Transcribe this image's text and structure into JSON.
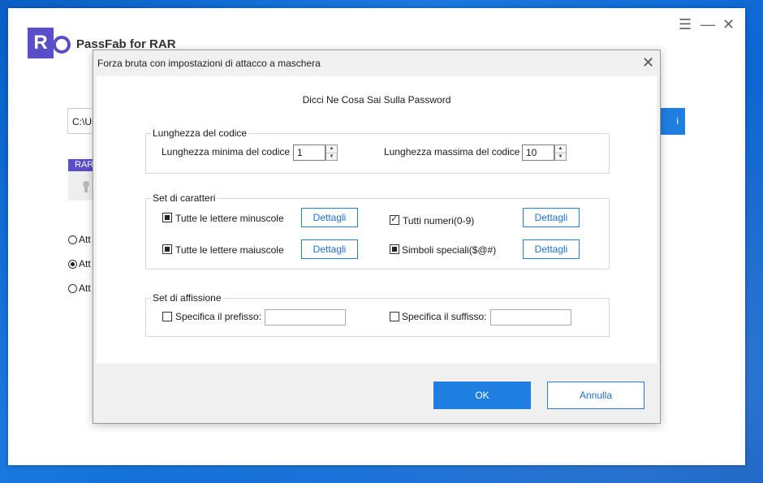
{
  "app": {
    "title": "PassFab for RAR",
    "logo_letter": "R",
    "path_value": "C:\\Us",
    "browse_label": "i",
    "rar_tab": "RAR",
    "attack_options": [
      "Att",
      "Att",
      "Att"
    ]
  },
  "dialog": {
    "title": "Forza bruta con impostazioni di attacco a maschera",
    "heading": "Dicci Ne Cosa Sai Sulla Password",
    "length_group": {
      "legend": "Lunghezza del codice",
      "min_label": "Lunghezza minima del codice",
      "min_value": "1",
      "max_label": "Lunghezza massima del codice",
      "max_value": "10"
    },
    "charset_group": {
      "legend": "Set di caratteri",
      "lowercase_label": "Tutte le lettere minuscole",
      "uppercase_label": "Tutte le lettere maiuscole",
      "numbers_label": "Tutti numeri(0-9)",
      "symbols_label": "Simboli speciali($@#)",
      "details_label": "Dettagli"
    },
    "affix_group": {
      "legend": "Set di affissione",
      "prefix_label": "Specifica il prefisso:",
      "suffix_label": "Specifica il suffisso:"
    },
    "ok_label": "OK",
    "cancel_label": "Annulla"
  },
  "icons": [
    "menu-icon",
    "minimize-icon",
    "close-icon",
    "lock-icon",
    "spin-up-icon",
    "spin-down-icon"
  ],
  "colors": {
    "accent": "#1e7fe0",
    "brand": "#5a4fc8"
  }
}
